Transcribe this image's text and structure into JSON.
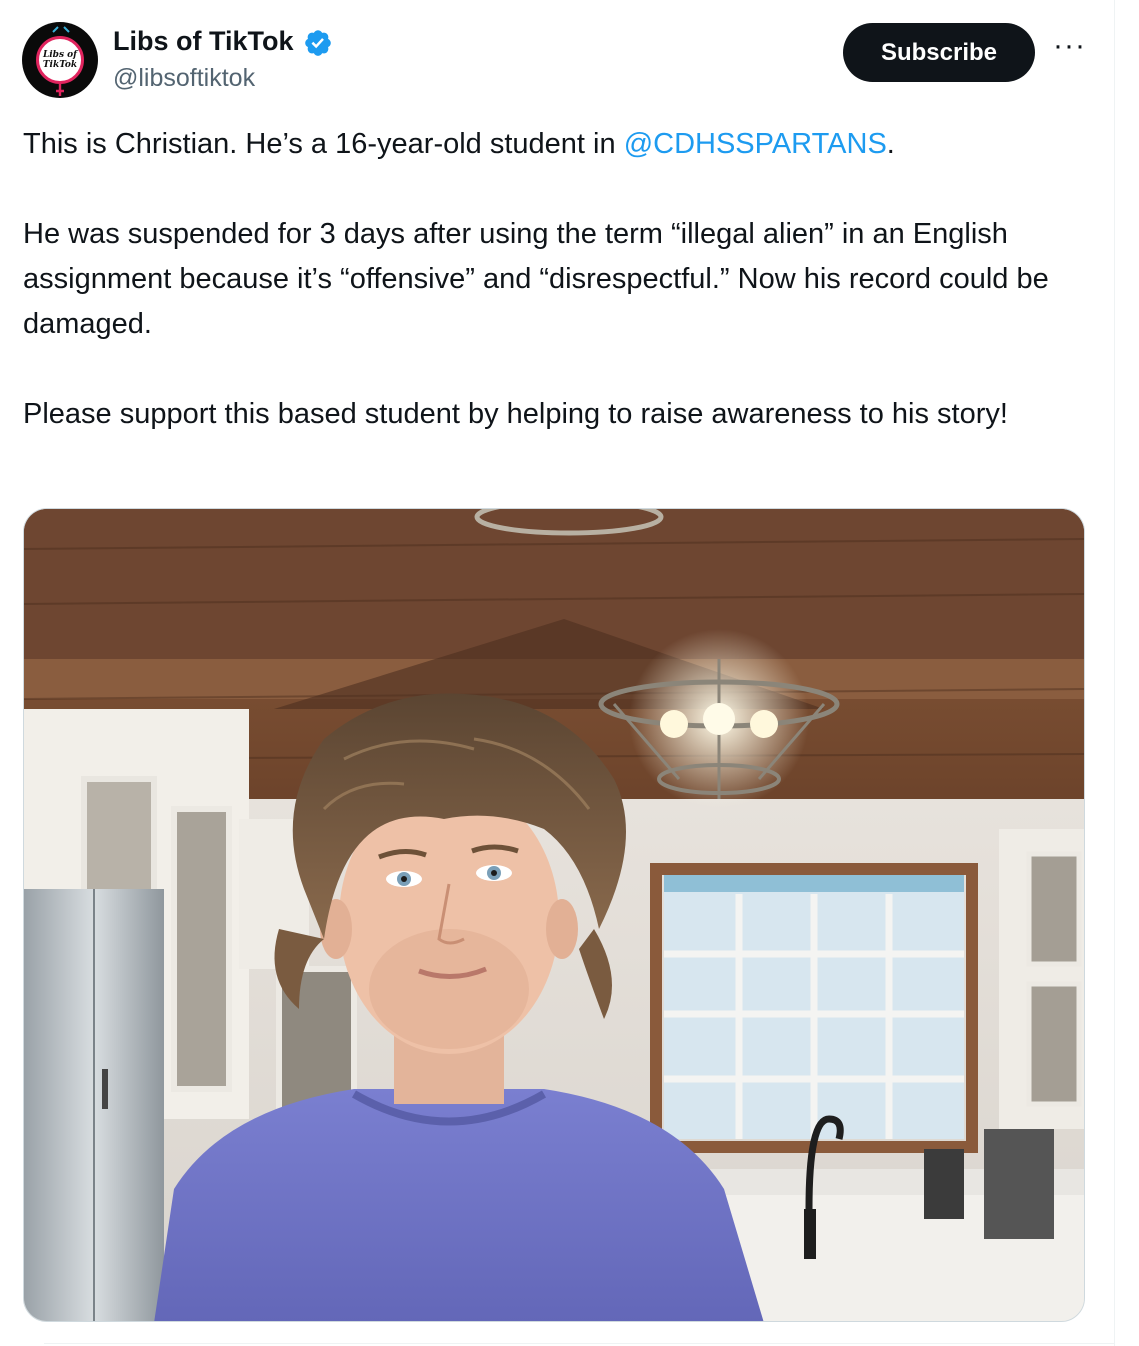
{
  "author": {
    "display_name": "Libs of TikTok",
    "handle": "@libsoftiktok",
    "avatar_text": [
      "Libs of",
      "TikTok"
    ],
    "verified": true
  },
  "actions": {
    "subscribe_label": "Subscribe",
    "more_icon": "···"
  },
  "tweet": {
    "line1_prefix": "This is Christian. He’s a 16-year-old student in ",
    "mention": "@CDHSSPARTANS",
    "line1_suffix": ".",
    "paragraph2": "He was suspended for 3 days after using the term “illegal alien” in an English assignment because it’s “offensive” and “disrespectful.” Now his record could be damaged.",
    "paragraph3": "Please support this based student by helping to raise awareness to his story!"
  },
  "colors": {
    "text": "#0f1419",
    "secondary": "#536471",
    "link": "#1d9bf0",
    "verified": "#1d9bf0",
    "button_bg": "#0f1419"
  }
}
